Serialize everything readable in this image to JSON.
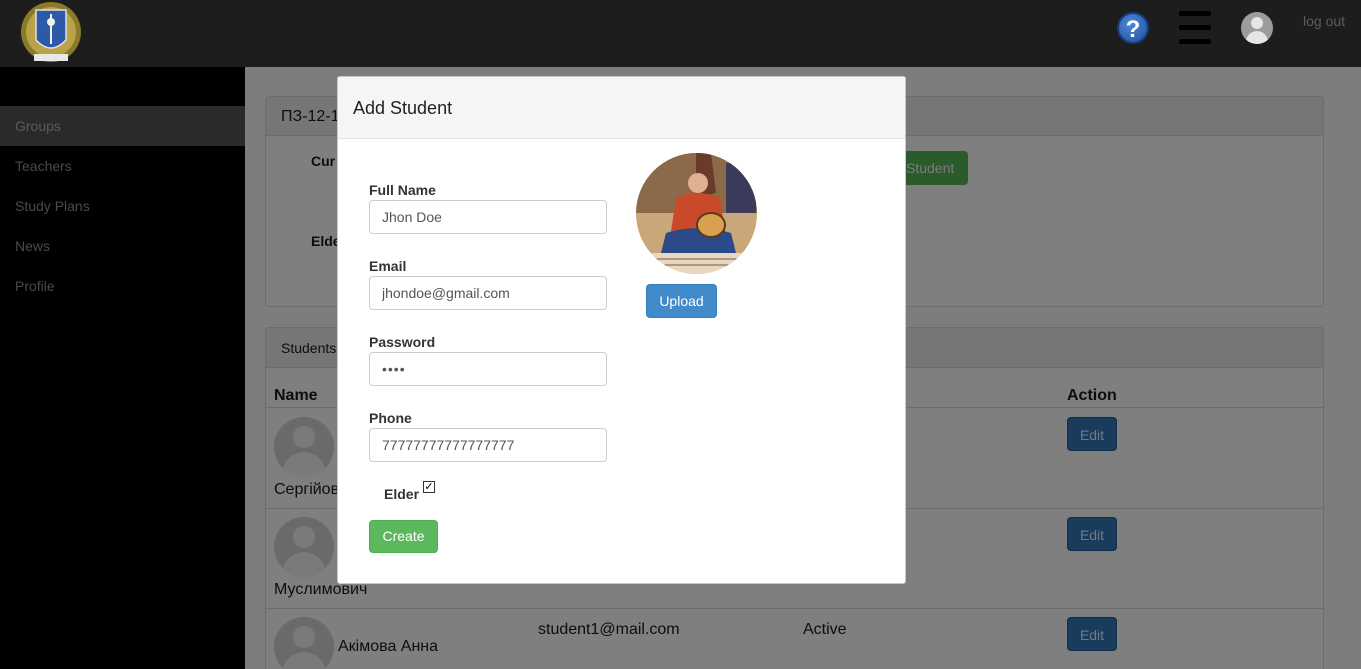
{
  "header": {
    "logout_label": "log out",
    "help_symbol": "?",
    "icons": [
      "university-logo-icon",
      "help-icon",
      "menu-icon",
      "user-avatar-icon"
    ]
  },
  "sidebar": {
    "items": [
      {
        "label": "Groups",
        "active": true
      },
      {
        "label": "Teachers",
        "active": false
      },
      {
        "label": "Study Plans",
        "active": false
      },
      {
        "label": "News",
        "active": false
      },
      {
        "label": "Profile",
        "active": false
      }
    ]
  },
  "group_panel": {
    "title": "ПЗ-12-1",
    "curator_label": "Cur",
    "elder_label": "Elde",
    "add_student_label": "Student"
  },
  "students_panel": {
    "title": "Students",
    "columns": {
      "name": "Name",
      "action": "Action"
    },
    "rows": [
      {
        "name": "Сергійов",
        "email": "",
        "status": "",
        "action": "Edit"
      },
      {
        "name": "Муслимович",
        "email": "",
        "status": "",
        "action": "Edit"
      },
      {
        "name": "Акімова Анна",
        "email": "student1@mail.com",
        "status": "Active",
        "action": "Edit"
      }
    ]
  },
  "modal": {
    "title": "Add Student",
    "full_name_label": "Full Name",
    "full_name_value": "Jhon Doe",
    "email_label": "Email",
    "email_value": "jhondoe@gmail.com",
    "password_label": "Password",
    "password_value": "••••",
    "phone_label": "Phone",
    "phone_value": "77777777777777777",
    "elder_label": "Elder",
    "elder_checked": true,
    "create_label": "Create",
    "upload_label": "Upload"
  },
  "colors": {
    "create_button": "#5cb85c",
    "upload_button": "#428bca",
    "topbar": "#1d1d1d",
    "sidebar": "#000000"
  }
}
